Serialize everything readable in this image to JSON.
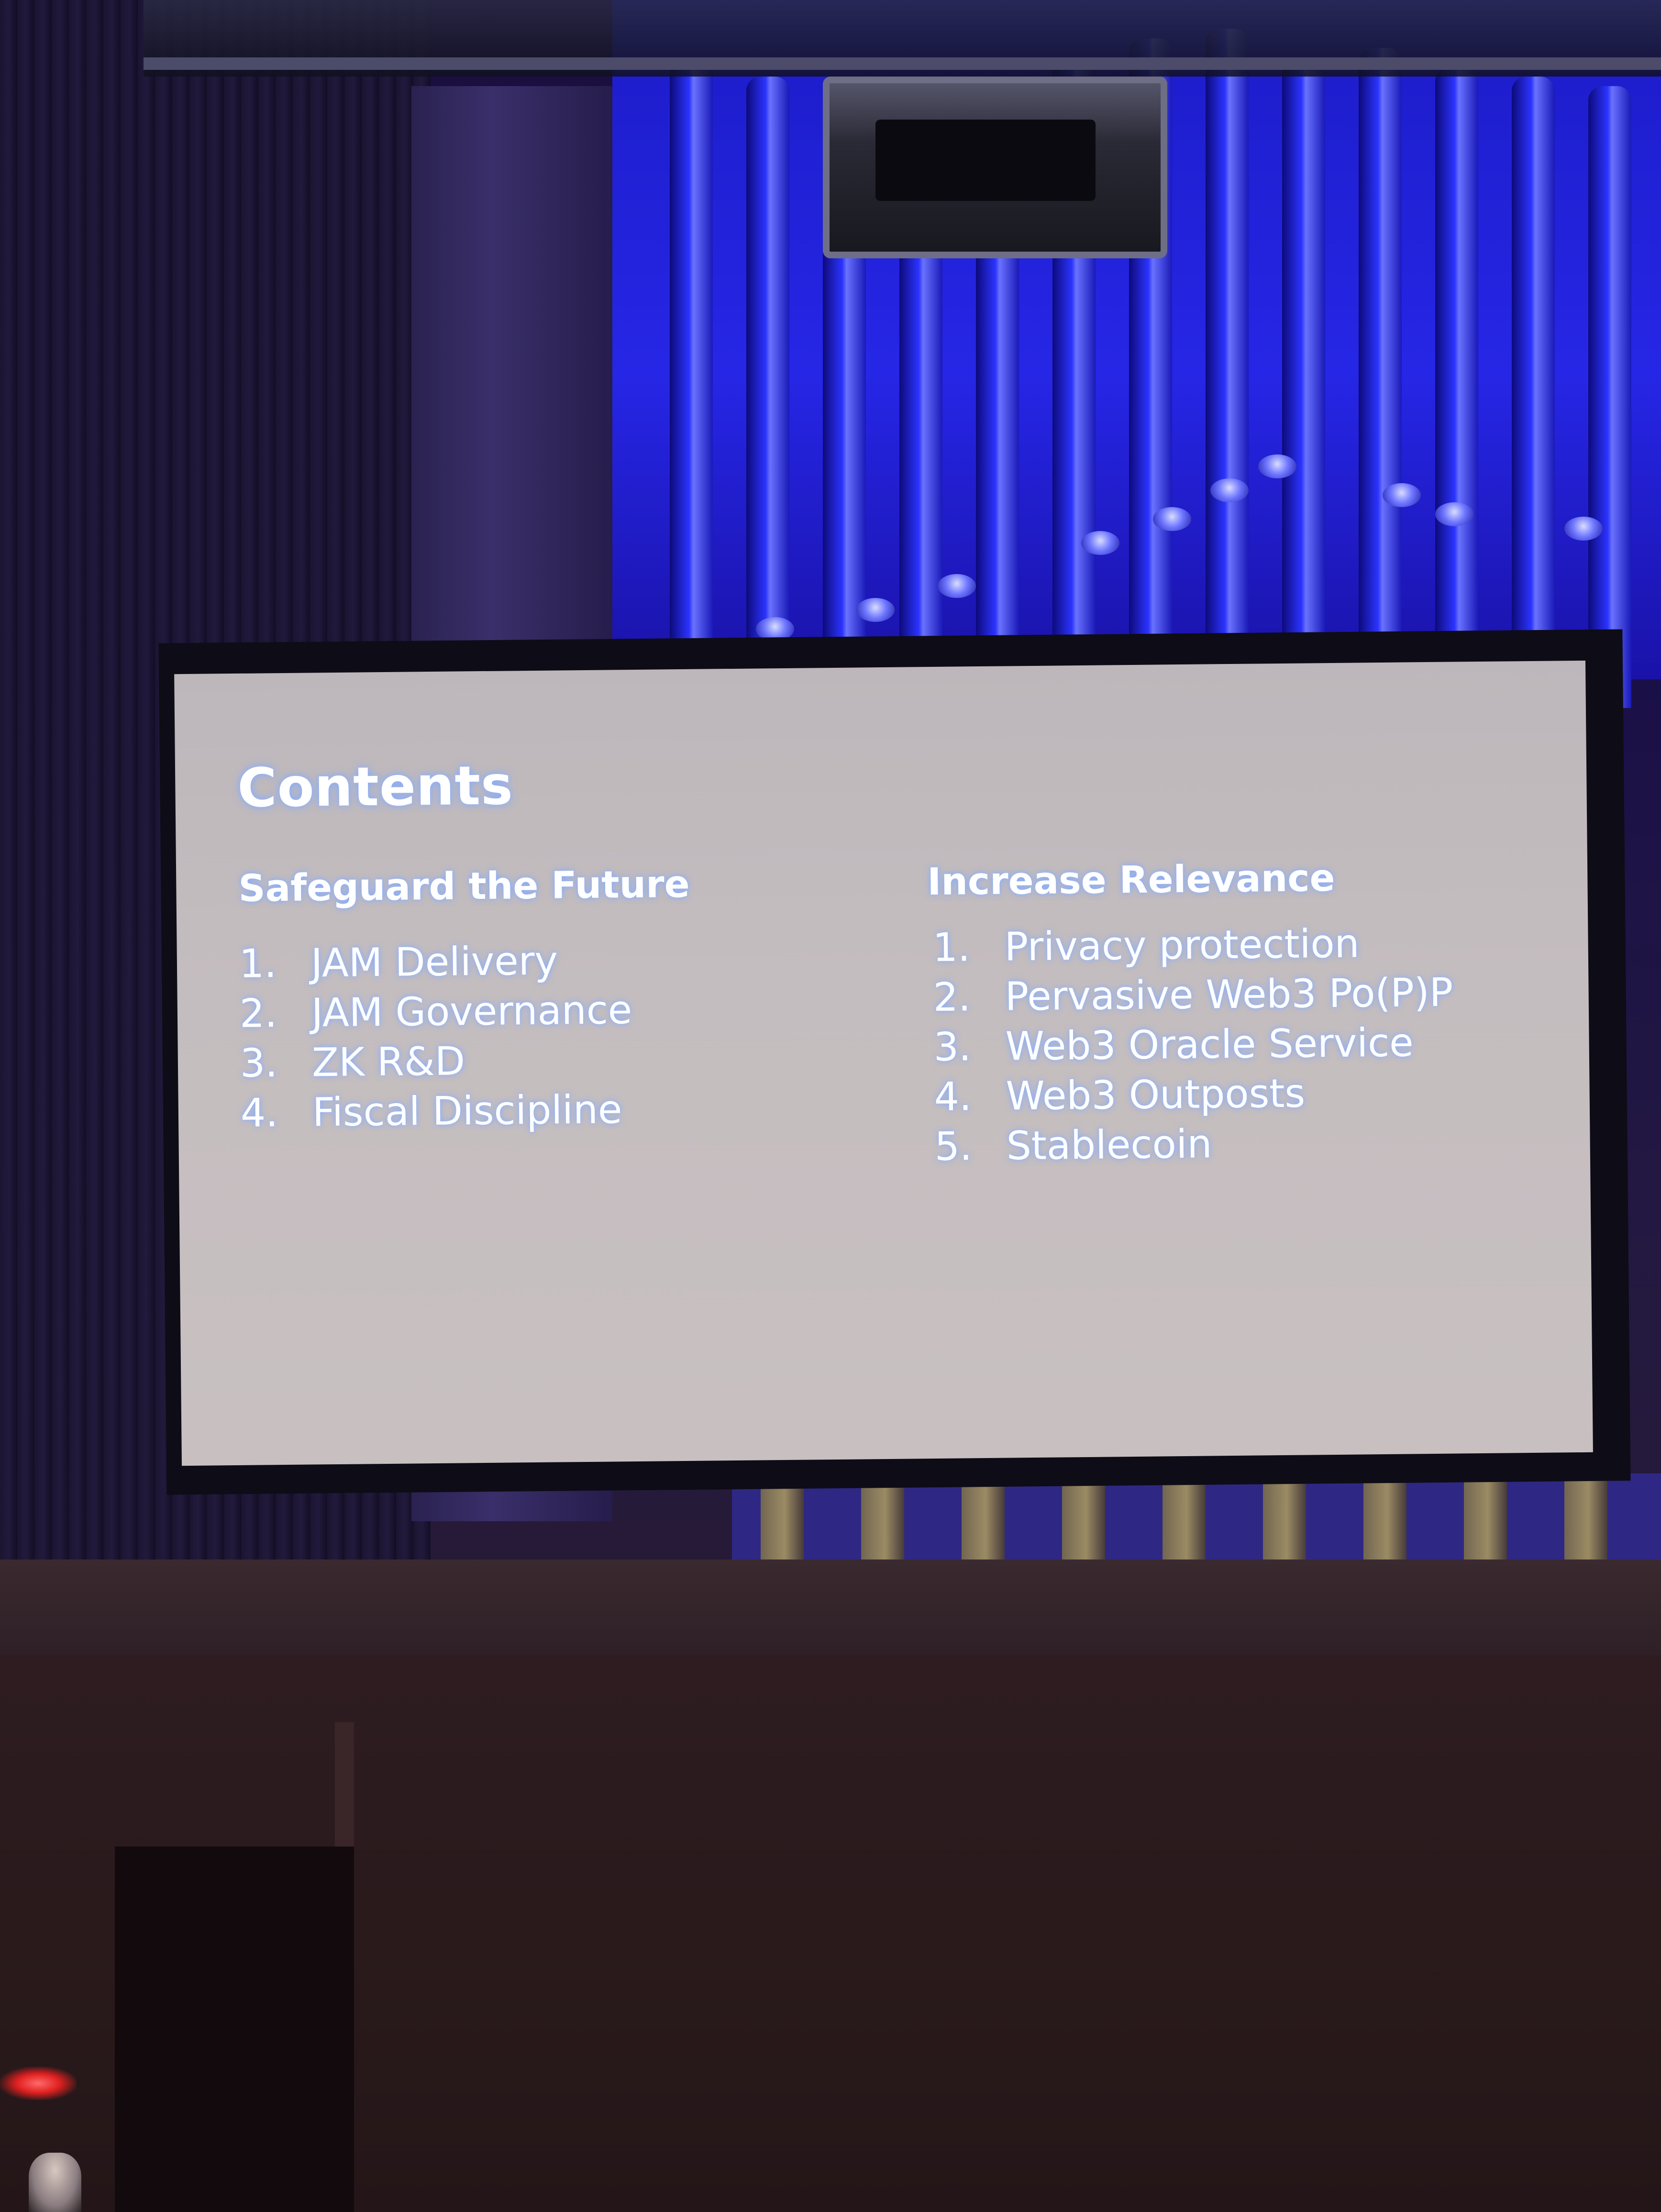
{
  "slide": {
    "title": "Contents",
    "columns": [
      {
        "heading": "Safeguard the Future",
        "items": [
          {
            "num": "1.",
            "label": "JAM Delivery"
          },
          {
            "num": "2.",
            "label": "JAM Governance"
          },
          {
            "num": "3.",
            "label": "ZK R&D"
          },
          {
            "num": "4.",
            "label": "Fiscal Discipline"
          }
        ]
      },
      {
        "heading": "Increase Relevance",
        "items": [
          {
            "num": "1.",
            "label": "Privacy protection"
          },
          {
            "num": "2.",
            "label": "Pervasive Web3 Po(P)P"
          },
          {
            "num": "3.",
            "label": "Web3 Oracle Service"
          },
          {
            "num": "4.",
            "label": "Web3 Outposts"
          },
          {
            "num": "5.",
            "label": "Stablecoin"
          }
        ]
      }
    ]
  },
  "colors": {
    "stage_lighting": "#2626e6",
    "screen_surface": "#c4bdbf",
    "text_glow": "#7ea8ff"
  }
}
